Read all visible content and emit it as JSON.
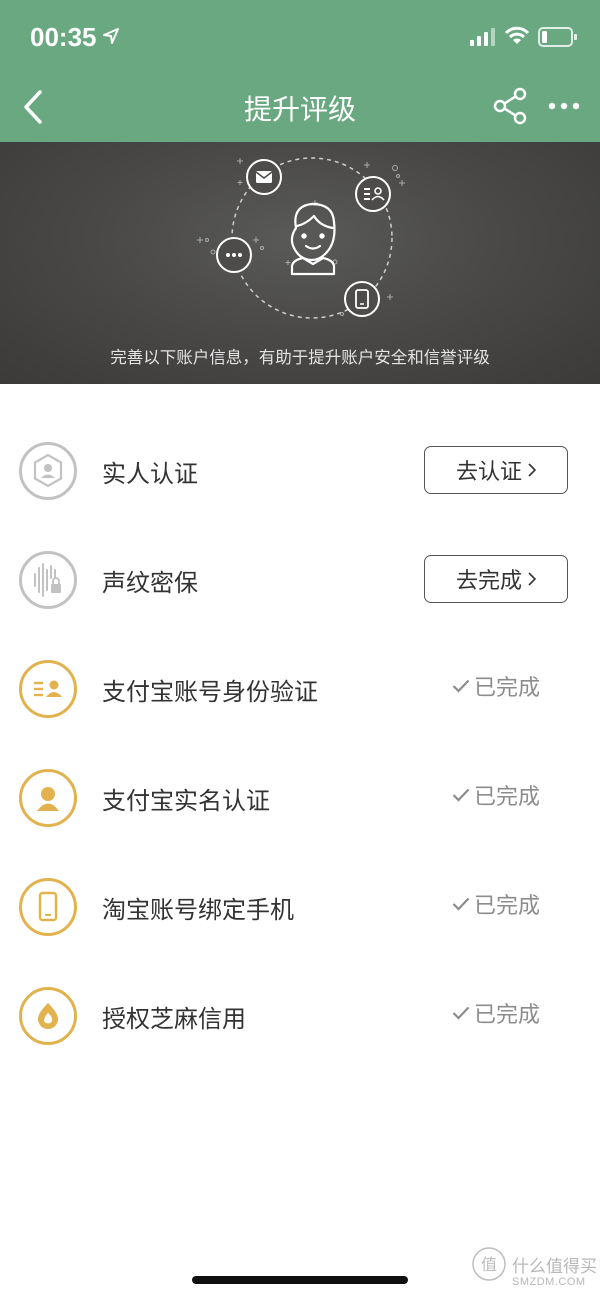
{
  "status_bar": {
    "time": "00:35",
    "icons": [
      "location-arrow-icon",
      "signal-icon",
      "wifi-icon",
      "battery-icon"
    ]
  },
  "nav": {
    "title": "提升评级",
    "back_icon": "chevron-left-icon",
    "share_icon": "share-icon",
    "more_icon": "more-icon"
  },
  "hero": {
    "caption": "完善以下账户信息，有助于提升账户安全和信誉评级",
    "orbit_icons": [
      "mail-icon",
      "id-card-icon",
      "more-icon",
      "phone-icon"
    ],
    "center_icon": "user-avatar-icon"
  },
  "items": [
    {
      "label": "实人认证",
      "status": "action",
      "button": "去认证",
      "icon": "face-scan-icon"
    },
    {
      "label": "声纹密保",
      "status": "action",
      "button": "去完成",
      "icon": "voiceprint-icon"
    },
    {
      "label": "支付宝账号身份验证",
      "status": "done",
      "done_text": "已完成",
      "icon": "id-card-icon"
    },
    {
      "label": "支付宝实名认证",
      "status": "done",
      "done_text": "已完成",
      "icon": "person-icon"
    },
    {
      "label": "淘宝账号绑定手机",
      "status": "done",
      "done_text": "已完成",
      "icon": "phone-icon"
    },
    {
      "label": "授权芝麻信用",
      "status": "done",
      "done_text": "已完成",
      "icon": "sesame-icon"
    }
  ],
  "watermark": {
    "title": "什么值得买",
    "subtitle": "SMZDM.COM"
  },
  "colors": {
    "nav_green": "#6aa882",
    "gold": "#e2b24e",
    "gray_icon": "#bdbdbd",
    "done_gray": "#8c8c8c"
  }
}
